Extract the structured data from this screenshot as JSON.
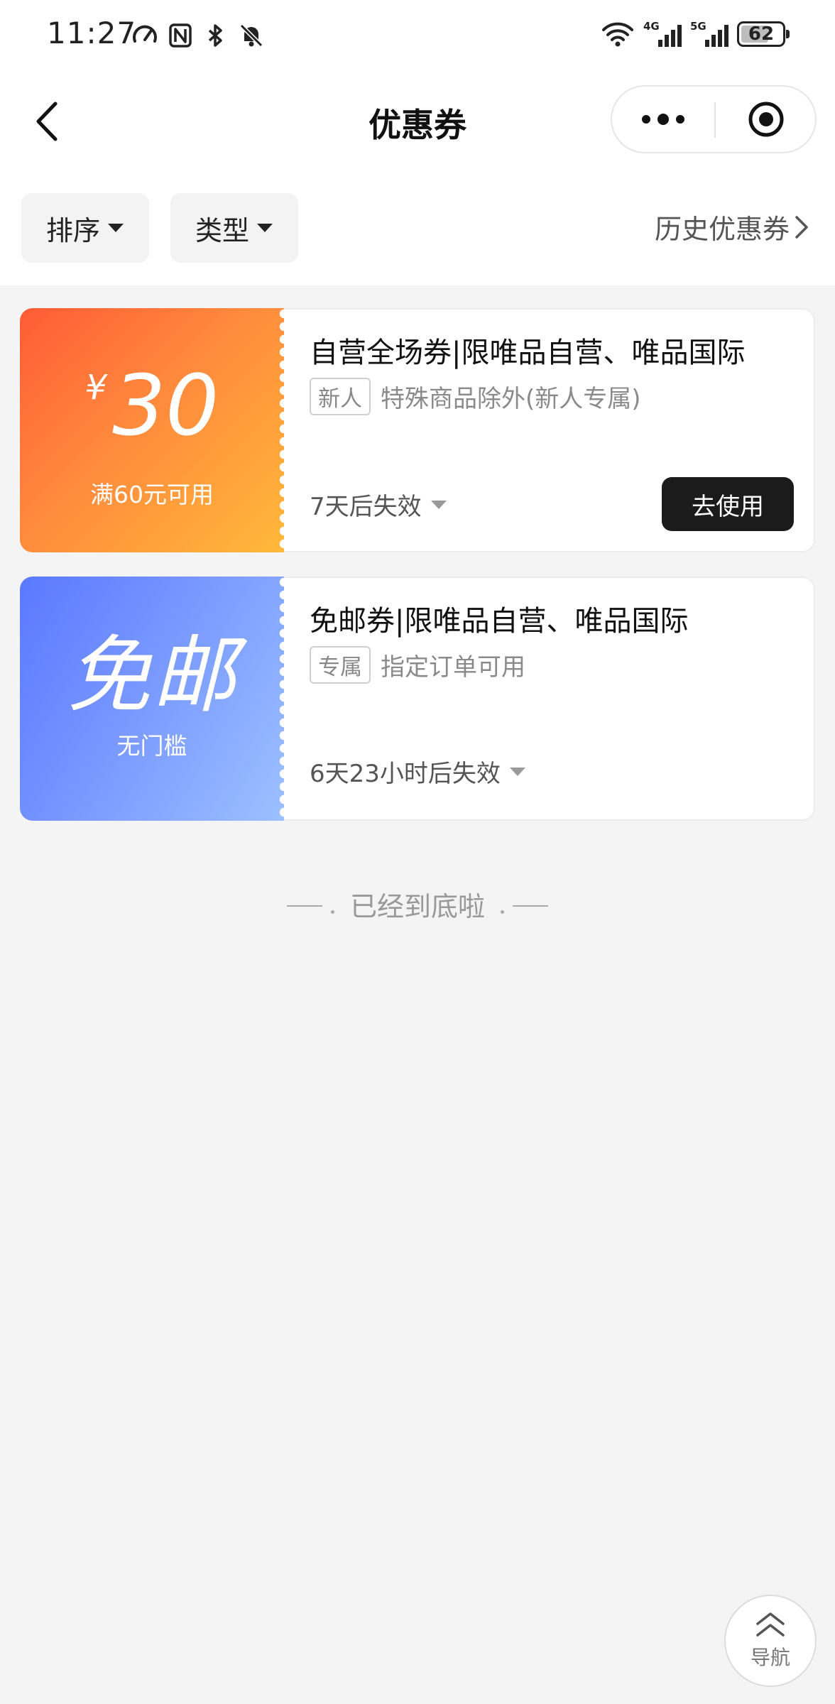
{
  "status_bar": {
    "time": "11:27",
    "left_icons": [
      "speedometer-icon",
      "nfc-icon",
      "bluetooth-icon",
      "bell-off-icon"
    ],
    "signal_1_label": "4G",
    "signal_2_label": "5G",
    "battery": "62"
  },
  "nav": {
    "title": "优惠券",
    "back_icon": "chevron-left-icon",
    "more_icon": "more-dots-icon",
    "close_icon": "target-circle-icon"
  },
  "filters": {
    "sort_label": "排序",
    "type_label": "类型",
    "history_label": "历史优惠券"
  },
  "coupons": [
    {
      "currency": "¥",
      "amount": "30",
      "condition": "满60元可用",
      "title": "自营全场券|限唯品自营、唯品国际",
      "badge": "新人",
      "description": "特殊商品除外(新人专属)",
      "expiry": "7天后失效",
      "action_label": "去使用",
      "accent_colors": [
        "#ff5b36",
        "#ffb83a"
      ]
    },
    {
      "big_text": "免邮",
      "condition": "无门槛",
      "title": "免邮券|限唯品自营、唯品国际",
      "badge": "专属",
      "description": "指定订单可用",
      "expiry": "6天23小时后失效",
      "accent_colors": [
        "#5a78ff",
        "#9cc0ff"
      ]
    }
  ],
  "end_hint": "已经到底啦",
  "float_nav": {
    "label": "导航",
    "icon": "double-chevron-up-icon"
  }
}
